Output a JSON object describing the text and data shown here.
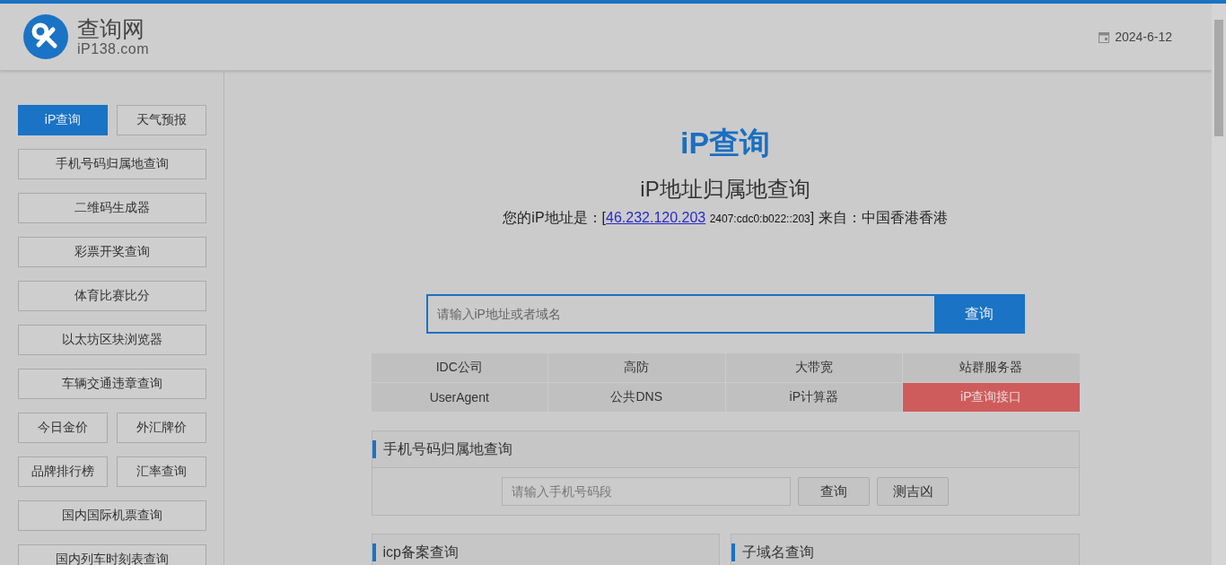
{
  "header": {
    "logo_title": "查询网",
    "logo_domain": "iP138.com",
    "date": "2024-6-12"
  },
  "sidebar": {
    "items": [
      {
        "label": "iP查询",
        "kind": "half",
        "selected": true
      },
      {
        "label": "天气预报",
        "kind": "half",
        "selected": false
      },
      {
        "label": "手机号码归属地查询",
        "kind": "full",
        "selected": false
      },
      {
        "label": "二维码生成器",
        "kind": "full",
        "selected": false
      },
      {
        "label": "彩票开奖查询",
        "kind": "full",
        "selected": false
      },
      {
        "label": "体育比赛比分",
        "kind": "full",
        "selected": false
      },
      {
        "label": "以太坊区块浏览器",
        "kind": "full",
        "selected": false
      },
      {
        "label": "车辆交通违章查询",
        "kind": "full",
        "selected": false
      },
      {
        "label": "今日金价",
        "kind": "half",
        "selected": false
      },
      {
        "label": "外汇牌价",
        "kind": "half",
        "selected": false
      },
      {
        "label": "品牌排行榜",
        "kind": "half",
        "selected": false
      },
      {
        "label": "汇率查询",
        "kind": "half",
        "selected": false
      },
      {
        "label": "国内国际机票查询",
        "kind": "full",
        "selected": false
      },
      {
        "label": "国内列车时刻表查询",
        "kind": "full",
        "selected": false
      }
    ]
  },
  "main": {
    "title": "iP查询",
    "subtitle": "iP地址归属地查询",
    "address": {
      "prefix": "您的iP地址是：[",
      "ip_link": "46.232.120.203",
      "ipv6": "2407:cdc0:b022::203",
      "suffix": "] 来自：中国香港香港"
    },
    "search": {
      "placeholder": "请输入iP地址或者域名",
      "button": "查询"
    },
    "quick_links": [
      {
        "label": "IDC公司",
        "highlighted": false
      },
      {
        "label": "高防",
        "highlighted": false
      },
      {
        "label": "大带宽",
        "highlighted": false
      },
      {
        "label": "站群服务器",
        "highlighted": false
      },
      {
        "label": "UserAgent",
        "highlighted": false
      },
      {
        "label": "公共DNS",
        "highlighted": false
      },
      {
        "label": "iP计算器",
        "highlighted": false
      },
      {
        "label": "iP查询接口",
        "highlighted": true
      }
    ],
    "phone_section": {
      "title": "手机号码归属地查询",
      "placeholder": "请输入手机号码段",
      "buttons": [
        "查询",
        "测吉凶"
      ]
    },
    "bottom_sections": [
      {
        "title": "icp备案查询"
      },
      {
        "title": "子域名查询"
      }
    ]
  }
}
